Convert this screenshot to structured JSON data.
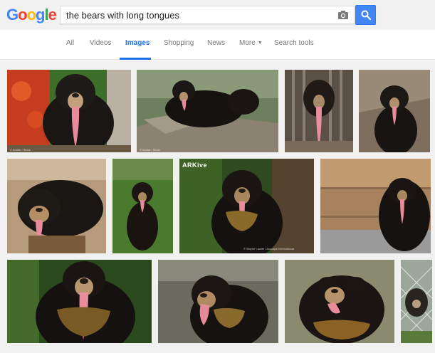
{
  "logo": {
    "letters": [
      "G",
      "o",
      "o",
      "g",
      "l",
      "e"
    ],
    "colors": [
      "#4285f4",
      "#ea4335",
      "#fbbc05",
      "#4285f4",
      "#34a853",
      "#ea4335"
    ]
  },
  "search": {
    "query": "the bears with long tongues"
  },
  "tabs": [
    {
      "label": "All",
      "active": false
    },
    {
      "label": "Videos",
      "active": false
    },
    {
      "label": "Images",
      "active": true
    },
    {
      "label": "Shopping",
      "active": false
    },
    {
      "label": "News",
      "active": false
    },
    {
      "label": "More",
      "active": false,
      "has_caret": true
    },
    {
      "label": "Search tools",
      "active": false
    }
  ],
  "watermarks": {
    "arkive_logo": "ARKive",
    "credit_arkive": "© Wayne Lawler / Auscape International",
    "credit_small": "© Adobe / Stock"
  },
  "colors": {
    "accent_blue": "#4285f4",
    "nav_active": "#1a73e8",
    "bg_gray": "#f1f1f1"
  }
}
